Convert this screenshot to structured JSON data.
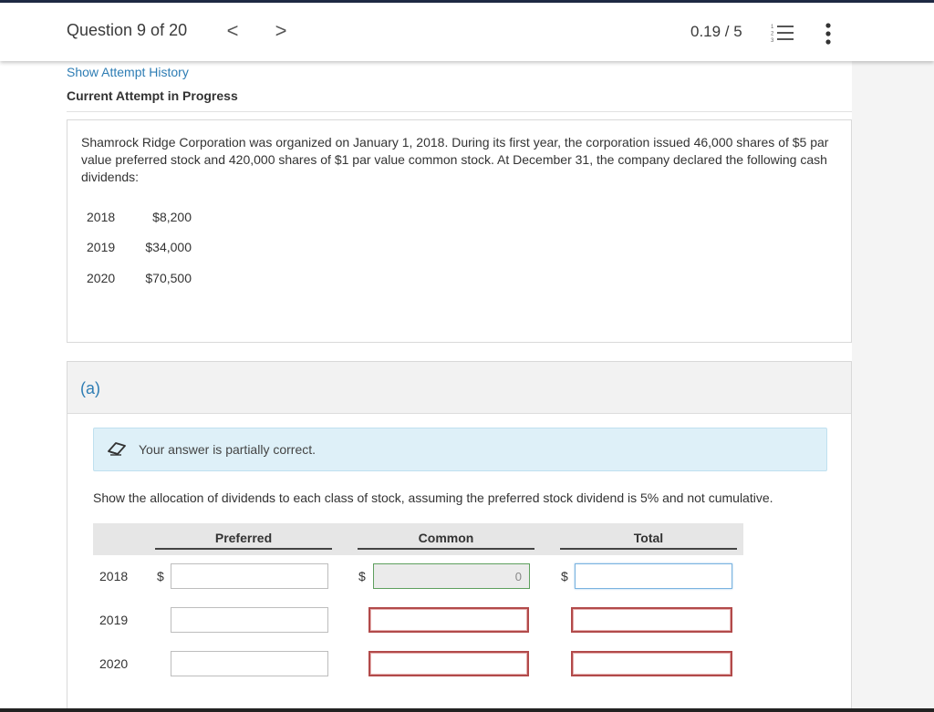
{
  "header": {
    "question_label": "Question 9 of 20",
    "prev_glyph": "<",
    "next_glyph": ">",
    "score": "0.19 / 5",
    "list_icon": "numbered-list-icon",
    "more_icon": "vertical-ellipsis-icon"
  },
  "attempt": {
    "history_link": "Show Attempt History",
    "current_label": "Current Attempt in Progress"
  },
  "problem": {
    "text": "Shamrock Ridge Corporation was organized on January 1, 2018. During its first year, the corporation issued 46,000 shares of $5 par value preferred stock and 420,000 shares of $1 par value common stock. At December 31, the company declared the following cash dividends:",
    "dividends": [
      {
        "year": "2018",
        "amount": "$8,200"
      },
      {
        "year": "2019",
        "amount": "$34,000"
      },
      {
        "year": "2020",
        "amount": "$70,500"
      }
    ]
  },
  "part_a": {
    "label": "(a)",
    "feedback_icon": "eraser-icon",
    "feedback": "Your answer is partially correct.",
    "instruction": "Show the allocation of dividends to each class of stock, assuming the preferred stock dividend is 5% and not cumulative.",
    "columns": [
      "Preferred",
      "Common",
      "Total"
    ],
    "currency": "$",
    "rows": [
      {
        "year": "2018",
        "preferred": "",
        "common": "0",
        "total": ""
      },
      {
        "year": "2019",
        "preferred": "",
        "common": "",
        "total": ""
      },
      {
        "year": "2020",
        "preferred": "",
        "common": "",
        "total": ""
      }
    ]
  },
  "colors": {
    "link": "#2e7db4",
    "feedback_bg": "#def0f8",
    "correct_border": "#5e9f5e",
    "wrong_border": "#b24a4a"
  }
}
